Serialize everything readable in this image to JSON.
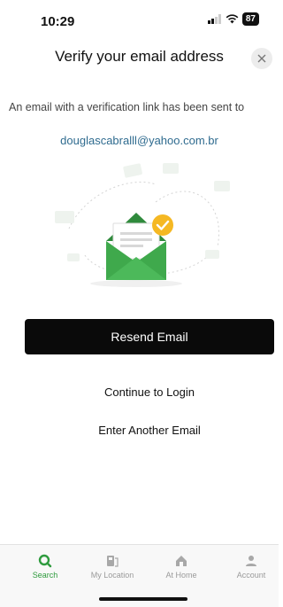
{
  "status_bar": {
    "time": "10:29",
    "battery": "87"
  },
  "header": {
    "title": "Verify your email address"
  },
  "body": {
    "message": "An email with a verification link has been sent to",
    "email": "douglascabralll@yahoo.com.br"
  },
  "actions": {
    "resend_label": "Resend Email",
    "continue_label": "Continue to Login",
    "another_label": "Enter Another Email"
  },
  "tabs": [
    {
      "label": "Search",
      "icon": "search-icon",
      "active": true
    },
    {
      "label": "My Location",
      "icon": "location-icon",
      "active": false
    },
    {
      "label": "At Home",
      "icon": "home-icon",
      "active": false
    },
    {
      "label": "Account",
      "icon": "account-icon",
      "active": false
    }
  ],
  "colors": {
    "accent": "#2f9b3e",
    "envelope": "#3fa94c",
    "check": "#f5b823",
    "link": "#2f6b8f"
  }
}
